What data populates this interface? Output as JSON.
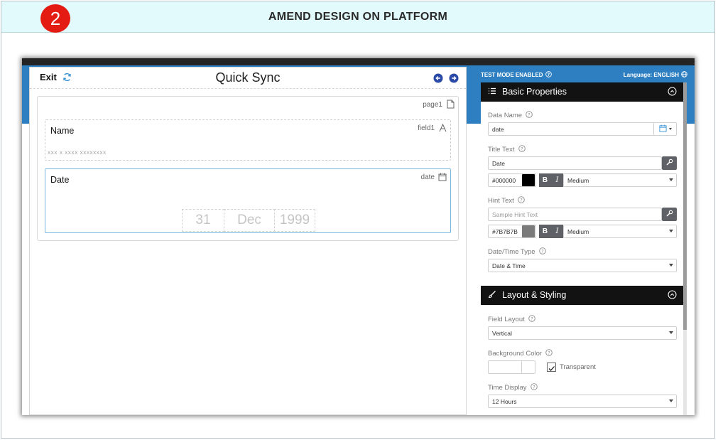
{
  "banner": {
    "step": "2",
    "title": "AMEND DESIGN ON PLATFORM"
  },
  "canvas": {
    "exit_label": "Exit",
    "title": "Quick Sync",
    "page_label": "page1",
    "fields": [
      {
        "title": "Name",
        "id": "field1",
        "hint": "xxx x xxxx xxxxxxxx"
      },
      {
        "title": "Date",
        "id": "date",
        "day": "31",
        "month": "Dec",
        "year": "1999"
      }
    ]
  },
  "panel": {
    "test_mode": "TEST MODE ENABLED",
    "language": "Language: ENGLISH",
    "basic_properties": {
      "title": "Basic Properties",
      "data_name_label": "Data Name",
      "data_name_value": "date",
      "title_text_label": "Title Text",
      "title_text_value": "Date",
      "title_color": "#000000",
      "title_weight": "Medium",
      "hint_text_label": "Hint Text",
      "hint_text_placeholder": "Sample Hint Text",
      "hint_color": "#7B7B7B",
      "hint_weight": "Medium",
      "date_time_type_label": "Date/Time Type",
      "date_time_type_value": "Date & Time",
      "bold_label": "B",
      "italic_label": "I"
    },
    "layout_styling": {
      "title": "Layout & Styling",
      "field_layout_label": "Field Layout",
      "field_layout_value": "Vertical",
      "background_color_label": "Background Color",
      "transparent_label": "Transparent",
      "transparent_checked": true,
      "time_display_label": "Time Display",
      "time_display_value": "12 Hours"
    }
  },
  "colors": {
    "badge": "#e31b12",
    "banner_bg": "#e3fafd",
    "topbar_blue": "#2d7fc1",
    "field_focus_border": "#79b8e0",
    "nav_button": "#2a49a6"
  }
}
